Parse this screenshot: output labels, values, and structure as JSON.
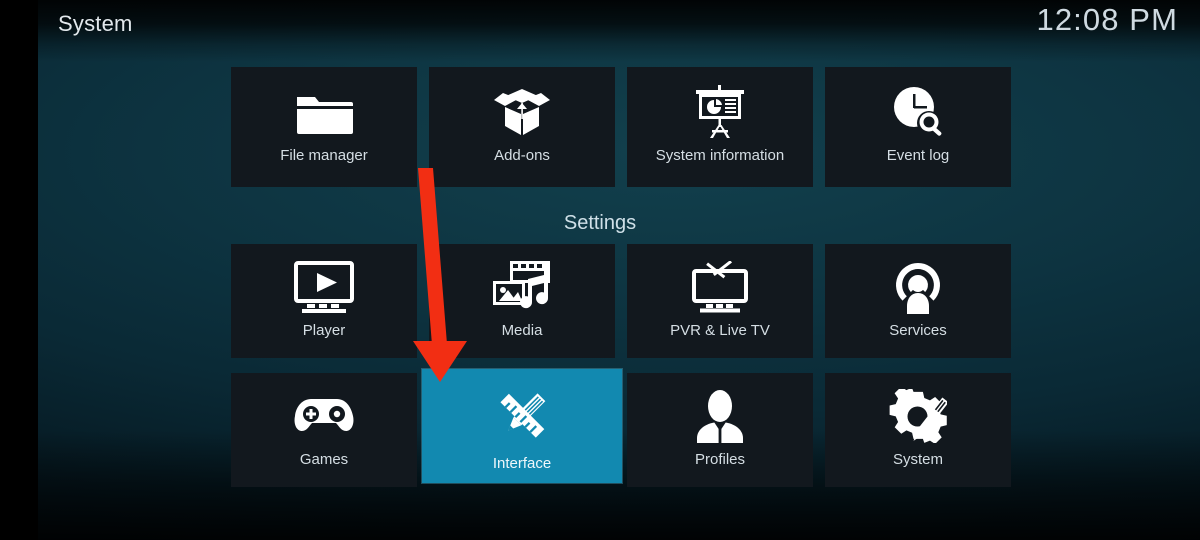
{
  "window": {
    "title": "System",
    "clock": "12:08 PM"
  },
  "category_label": "Settings",
  "colors": {
    "tile_background": "#12181E",
    "tile_selected": "#1289B0",
    "label_text": "#D5DEE4",
    "title_text": "#E2E8EC",
    "clock_text": "#CFDAE1",
    "annotation_arrow": "#F22E13",
    "page_background": "#0B323F"
  },
  "annotation": {
    "shape": "down-arrow",
    "color": "#F22E13",
    "points_to": "Interface"
  },
  "rows": [
    {
      "name": "utilities-row",
      "tiles": [
        {
          "label": "File manager",
          "icon": "folder-icon",
          "selected": false
        },
        {
          "label": "Add-ons",
          "icon": "open-box-icon",
          "selected": false
        },
        {
          "label": "System information",
          "icon": "presentation-board-icon",
          "selected": false
        },
        {
          "label": "Event log",
          "icon": "clock-search-icon",
          "selected": false
        }
      ]
    },
    {
      "name": "settings-row-1",
      "tiles": [
        {
          "label": "Player",
          "icon": "monitor-play-icon",
          "selected": false
        },
        {
          "label": "Media",
          "icon": "film-photo-music-icon",
          "selected": false
        },
        {
          "label": "PVR & Live TV",
          "icon": "tv-antenna-icon",
          "selected": false
        },
        {
          "label": "Services",
          "icon": "broadcast-person-icon",
          "selected": false
        }
      ]
    },
    {
      "name": "settings-row-2",
      "tiles": [
        {
          "label": "Games",
          "icon": "gamepad-icon",
          "selected": false
        },
        {
          "label": "Interface",
          "icon": "pencil-ruler-icon",
          "selected": true
        },
        {
          "label": "Profiles",
          "icon": "person-bust-icon",
          "selected": false
        },
        {
          "label": "System",
          "icon": "gear-wrench-icon",
          "selected": false
        }
      ]
    }
  ]
}
